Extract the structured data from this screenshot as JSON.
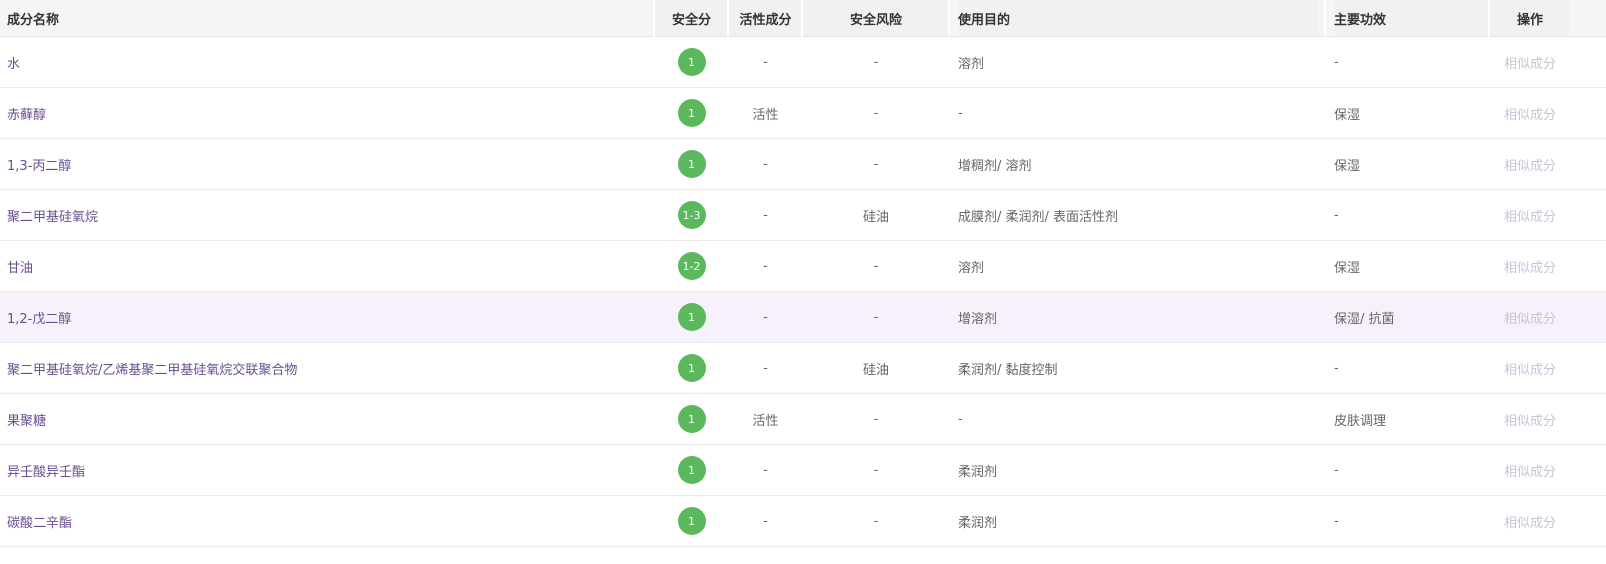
{
  "header": {
    "name": "成分名称",
    "score": "安全分",
    "active": "活性成分",
    "risk": "安全风险",
    "purpose": "使用目的",
    "effect": "主要功效",
    "op": "操作"
  },
  "rows": [
    {
      "name": "水",
      "score": "1",
      "active": "-",
      "risk": "-",
      "purpose": "溶剂",
      "effect": "-",
      "op": "相似成分"
    },
    {
      "name": "赤藓醇",
      "score": "1",
      "active": "活性",
      "risk": "-",
      "purpose": "-",
      "effect": "保湿",
      "op": "相似成分"
    },
    {
      "name": "1,3-丙二醇",
      "score": "1",
      "active": "-",
      "risk": "-",
      "purpose": "增稠剂/ 溶剂",
      "effect": "保湿",
      "op": "相似成分"
    },
    {
      "name": "聚二甲基硅氧烷",
      "score": "1-3",
      "active": "-",
      "risk": "硅油",
      "purpose": "成膜剂/ 柔润剂/ 表面活性剂",
      "effect": "-",
      "op": "相似成分"
    },
    {
      "name": "甘油",
      "score": "1-2",
      "active": "-",
      "risk": "-",
      "purpose": "溶剂",
      "effect": "保湿",
      "op": "相似成分"
    },
    {
      "name": "1,2-戊二醇",
      "score": "1",
      "active": "-",
      "risk": "-",
      "purpose": "增溶剂",
      "effect": "保湿/ 抗菌",
      "op": "相似成分"
    },
    {
      "name": "聚二甲基硅氧烷/乙烯基聚二甲基硅氧烷交联聚合物",
      "score": "1",
      "active": "-",
      "risk": "硅油",
      "purpose": "柔润剂/ 黏度控制",
      "effect": "-",
      "op": "相似成分"
    },
    {
      "name": "果聚糖",
      "score": "1",
      "active": "活性",
      "risk": "-",
      "purpose": "-",
      "effect": "皮肤调理",
      "op": "相似成分"
    },
    {
      "name": "异壬酸异壬酯",
      "score": "1",
      "active": "-",
      "risk": "-",
      "purpose": "柔润剂",
      "effect": "-",
      "op": "相似成分"
    },
    {
      "name": "碳酸二辛酯",
      "score": "1",
      "active": "-",
      "risk": "-",
      "purpose": "柔润剂",
      "effect": "-",
      "op": "相似成分"
    }
  ],
  "colors": {
    "badge": "#5cb85c",
    "name_link": "#6a4f8f",
    "op_link": "#c9c3d6",
    "highlight_row": "#f7f1fc"
  }
}
